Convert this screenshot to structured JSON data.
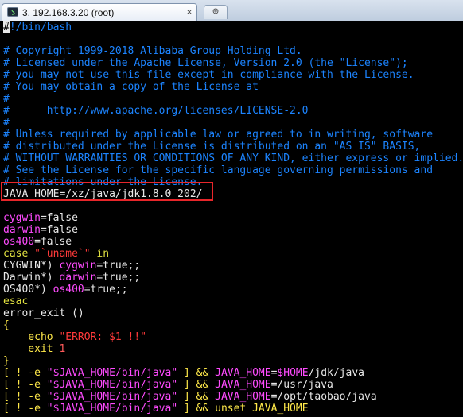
{
  "window": {
    "tab_label": "3. 192.168.3.20 (root)",
    "tab_close": "×",
    "new_tab": "⊕",
    "tab_icon": "terminal-icon"
  },
  "script": {
    "shebang_cursor": "#",
    "shebang_rest": "!/bin/bash",
    "license_1": "# Copyright 1999-2018 Alibaba Group Holding Ltd.",
    "license_2": "# Licensed under the Apache License, Version 2.0 (the \"License\");",
    "license_3": "# you may not use this file except in compliance with the License.",
    "license_4": "# You may obtain a copy of the License at",
    "license_5": "#",
    "license_6": "#      http://www.apache.org/licenses/LICENSE-2.0",
    "license_7": "#",
    "license_8": "# Unless required by applicable law or agreed to in writing, software",
    "license_9": "# distributed under the License is distributed on an \"AS IS\" BASIS,",
    "license_10": "# WITHOUT WARRANTIES OR CONDITIONS OF ANY KIND, either express or implied.",
    "license_11": "# See the License for the specific language governing permissions and",
    "license_12": "# limitations under the License.",
    "java_home_var": "JAVA_HOME",
    "java_home_eq": "=",
    "java_home_val": "/xz/java/jdk1.8.0_202/",
    "cyg_var": "cygwin",
    "cyg_val": "=false",
    "dar_var": "darwin",
    "dar_val": "=false",
    "os_var": "os400",
    "os_val": "=false",
    "case_kw": "case",
    "case_str": " \"`uname`\" ",
    "case_in": "in",
    "cygwin_pat": "CYGWIN*) ",
    "cygwin_var": "cygwin",
    "cygwin_set": "=true;;",
    "darwin_pat": "Darwin*) ",
    "darwin_var": "darwin",
    "darwin_set": "=true;;",
    "os400_pat": "OS400*) ",
    "os400_var": "os400",
    "os400_set": "=true;;",
    "esac": "esac",
    "error_exit": "error_exit ()",
    "brace_open": "{",
    "echo_cmd": "    echo ",
    "echo_str": "\"ERROR: $1 !!\"",
    "exit_cmd": "    exit ",
    "exit_code": "1",
    "brace_close": "}",
    "test1": {
      "a": "[ ! -e ",
      "b": "\"$JAVA_HOME/bin/java\"",
      "c": " ] && ",
      "d": "JAVA_HOME",
      "e": "=",
      "f": "$HOME",
      "g": "/jdk/java"
    },
    "test2": {
      "a": "[ ! -e ",
      "b": "\"$JAVA_HOME/bin/java\"",
      "c": " ] && ",
      "d": "JAVA_HOME",
      "e": "=/usr/java"
    },
    "test3": {
      "a": "[ ! -e ",
      "b": "\"$JAVA_HOME/bin/java\"",
      "c": " ] && ",
      "d": "JAVA_HOME",
      "e": "=/opt/taobao/java"
    },
    "test4": {
      "a": "[ ! -e ",
      "b": "\"$JAVA_HOME/bin/java\"",
      "c": " ] && ",
      "d": "unset JAVA_HOME"
    }
  }
}
